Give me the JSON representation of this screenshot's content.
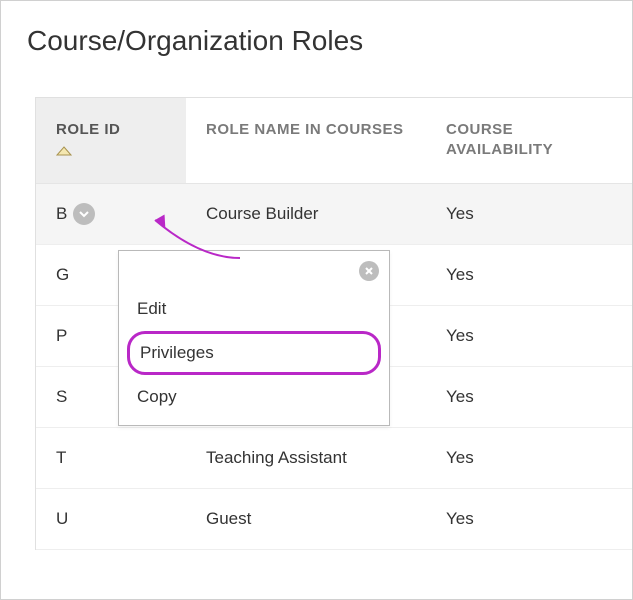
{
  "page": {
    "title": "Course/Organization Roles"
  },
  "table": {
    "headers": {
      "role_id": "ROLE ID",
      "role_name": "ROLE NAME IN COURSES",
      "availability": "COURSE AVAILABILITY"
    },
    "rows": [
      {
        "id": "B",
        "name": "Course Builder",
        "avail": "Yes",
        "highlight": true,
        "chevron": true
      },
      {
        "id": "G",
        "name": "",
        "avail": "Yes"
      },
      {
        "id": "P",
        "name": "",
        "avail": "Yes"
      },
      {
        "id": "S",
        "name": "",
        "avail": "Yes"
      },
      {
        "id": "T",
        "name": "Teaching Assistant",
        "avail": "Yes"
      },
      {
        "id": "U",
        "name": "Guest",
        "avail": "Yes"
      }
    ]
  },
  "dropdown": {
    "items": [
      {
        "label": "Edit"
      },
      {
        "label": "Privileges",
        "highlighted": true
      },
      {
        "label": "Copy"
      }
    ]
  },
  "colors": {
    "highlight_border": "#b928c7"
  }
}
